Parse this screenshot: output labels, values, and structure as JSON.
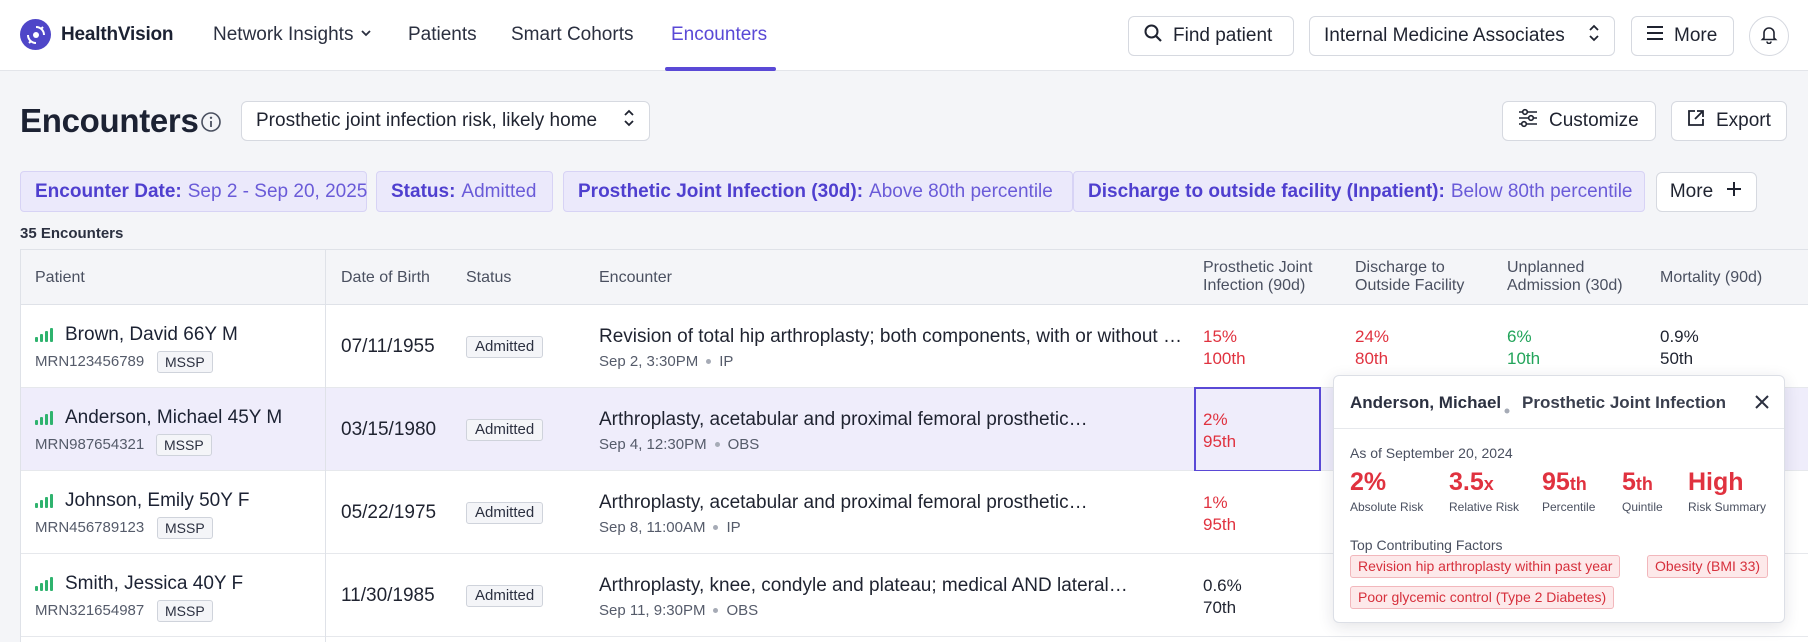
{
  "app": {
    "name": "HealthVision"
  },
  "nav": {
    "items": [
      {
        "label": "Network Insights",
        "has_dropdown": true
      },
      {
        "label": "Patients"
      },
      {
        "label": "Smart Cohorts"
      },
      {
        "label": "Encounters",
        "active": true
      }
    ],
    "find_patient": "Find patient",
    "organization": "Internal Medicine Associates",
    "more": "More"
  },
  "page": {
    "title": "Encounters",
    "view": "Prosthetic joint infection risk, likely home",
    "customize": "Customize",
    "export": "Export"
  },
  "filters": [
    {
      "key": "Encounter Date:",
      "value": "Sep 2 - Sep 20, 2025"
    },
    {
      "key": "Status:",
      "value": "Admitted"
    },
    {
      "key": "Prosthetic Joint Infection (30d):",
      "value": "Above 80th percentile"
    },
    {
      "key": "Discharge to outside facility (Inpatient):",
      "value": "Below 80th percentile"
    }
  ],
  "filters_more": "More",
  "count_label": "35 Encounters",
  "table": {
    "headers": {
      "patient": "Patient",
      "dob": "Date of Birth",
      "status": "Status",
      "encounter": "Encounter",
      "pji_1": "Prosthetic Joint",
      "pji_2": "Infection (90d)",
      "dof_1": "Discharge to",
      "dof_2": "Outside Facility",
      "ua_1": "Unplanned",
      "ua_2": "Admission (30d)",
      "mort": "Mortality (90d)"
    },
    "rows": [
      {
        "name": "Brown, David 66Y M",
        "mrn": "MRN123456789",
        "program": "MSSP",
        "dob": "07/11/1955",
        "status": "Admitted",
        "encounter": "Revision of total hip arthroplasty; both components, with or without autograft or allograft",
        "enc_time": "Sep 2, 3:30PM",
        "enc_type": "IP",
        "pji": {
          "value": "15%",
          "pct": "100th"
        },
        "dof": {
          "value": "24%",
          "pct": "80th"
        },
        "ua": {
          "value": "6%",
          "pct": "10th"
        },
        "mort": {
          "value": "0.9%",
          "pct": "50th"
        }
      },
      {
        "name": "Anderson, Michael 45Y M",
        "mrn": "MRN987654321",
        "program": "MSSP",
        "dob": "03/15/1980",
        "status": "Admitted",
        "encounter": "Arthroplasty, acetabular and proximal femoral prosthetic…",
        "enc_time": "Sep 4, 12:30PM",
        "enc_type": "OBS",
        "pji": {
          "value": "2%",
          "pct": "95th"
        }
      },
      {
        "name": "Johnson, Emily 50Y F",
        "mrn": "MRN456789123",
        "program": "MSSP",
        "dob": "05/22/1975",
        "status": "Admitted",
        "encounter": "Arthroplasty, acetabular and proximal femoral prosthetic…",
        "enc_time": "Sep 8, 11:00AM",
        "enc_type": "IP",
        "pji": {
          "value": "1%",
          "pct": "95th"
        }
      },
      {
        "name": "Smith, Jessica 40Y F",
        "mrn": "MRN321654987",
        "program": "MSSP",
        "dob": "11/30/1985",
        "status": "Admitted",
        "encounter": "Arthroplasty, knee, condyle and plateau; medical AND lateral…",
        "enc_time": "Sep 11, 9:30PM",
        "enc_type": "OBS",
        "pji": {
          "value": "0.6%",
          "pct": "70th"
        }
      }
    ]
  },
  "popover": {
    "patient": "Anderson, Michael",
    "measure": "Prosthetic Joint Infection",
    "as_of": "As of September 20, 2024",
    "metrics": [
      {
        "value": "2%",
        "suffix": "",
        "label": "Absolute Risk"
      },
      {
        "value": "3.5",
        "suffix": "x",
        "label": "Relative Risk"
      },
      {
        "value": "95",
        "suffix": "th",
        "label": "Percentile"
      },
      {
        "value": "5",
        "suffix": "th",
        "label": "Quintile"
      },
      {
        "value": "High",
        "suffix": "",
        "label": "Risk Summary"
      }
    ],
    "factors_title": "Top Contributing Factors",
    "factors": [
      "Revision hip arthroplasty within past year",
      "Obesity (BMI 33)",
      "Poor glycemic control (Type 2 Diabetes)"
    ]
  },
  "colors": {
    "accent": "#5a49d6",
    "risk_high": "#e0323f",
    "risk_low": "#22a45a",
    "signal": "#2fb36e"
  }
}
